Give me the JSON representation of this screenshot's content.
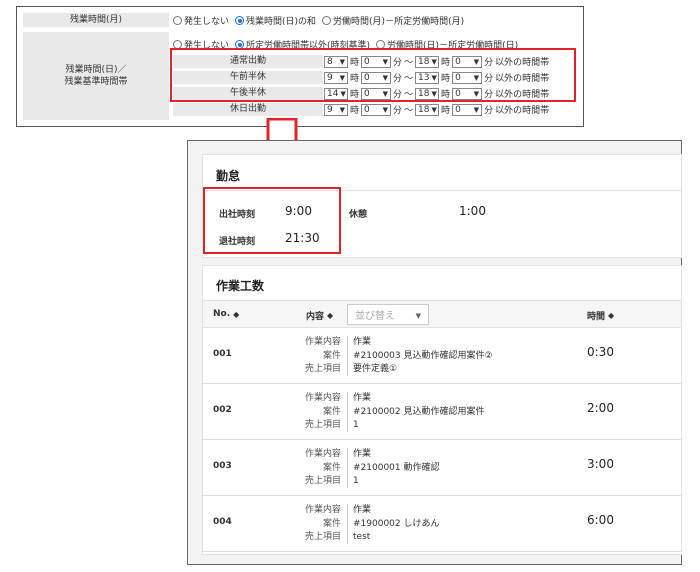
{
  "settings": {
    "overtime_month_label": "残業時間(月)",
    "overtime_month_options": [
      {
        "label": "発生しない",
        "checked": false
      },
      {
        "label": "残業時間(日)の和",
        "checked": true
      },
      {
        "label": "労働時間(月)－所定労働時間(月)",
        "checked": false
      }
    ],
    "overtime_day_label_line1": "残業時間(日)／",
    "overtime_day_label_line2": "残業基準時間帯",
    "overtime_day_options": [
      {
        "label": "発生しない",
        "checked": false
      },
      {
        "label": "所定労働時間帯以外(時刻基準)",
        "checked": true
      },
      {
        "label": "労働時間(日)－所定労働時間(日)",
        "checked": false
      }
    ],
    "hour_unit": "時",
    "minute_unit": "分",
    "range_sep": "～",
    "outside_suffix": "以外の時間帯",
    "time_rows": [
      {
        "label": "通常出勤",
        "start_h": "8",
        "start_m": "0",
        "end_h": "18",
        "end_m": "0"
      },
      {
        "label": "午前半休",
        "start_h": "9",
        "start_m": "0",
        "end_h": "13",
        "end_m": "0"
      },
      {
        "label": "午後半休",
        "start_h": "14",
        "start_m": "0",
        "end_h": "18",
        "end_m": "0"
      },
      {
        "label": "休日出勤",
        "start_h": "9",
        "start_m": "0",
        "end_h": "18",
        "end_m": "0"
      }
    ]
  },
  "attendance": {
    "title": "勤怠",
    "clock_in_label": "出社時刻",
    "clock_in_value": "9:00",
    "clock_out_label": "退社時刻",
    "clock_out_value": "21:30",
    "break_label": "休憩",
    "break_value": "1:00"
  },
  "worktime": {
    "title": "作業工数",
    "col_no": "No.",
    "col_content": "内容",
    "sort_placeholder": "並び替え",
    "col_time": "時間",
    "key_labels": [
      "作業内容",
      "案件",
      "売上項目"
    ],
    "rows": [
      {
        "no": "001",
        "work": "作業",
        "project": "#2100003 見込動作確認用案件②",
        "sales_item": "要件定義①",
        "time": "0:30"
      },
      {
        "no": "002",
        "work": "作業",
        "project": "#2100002 見込動作確認用案件",
        "sales_item": "1",
        "time": "2:00"
      },
      {
        "no": "003",
        "work": "作業",
        "project": "#2100001 動作確認",
        "sales_item": "1",
        "time": "3:00"
      },
      {
        "no": "004",
        "work": "作業",
        "project": "#1900002 しけあん",
        "sales_item": "test",
        "time": "6:00"
      }
    ]
  },
  "colors": {
    "highlight": "#e3232c",
    "radio_checked": "#1a73e8"
  },
  "icons": [
    "radio-icon",
    "chevron-down-icon",
    "down-arrow-icon",
    "sort-icon"
  ]
}
